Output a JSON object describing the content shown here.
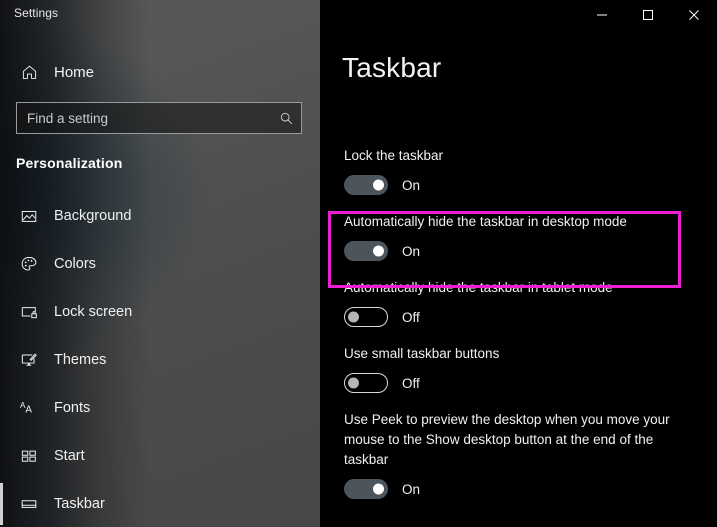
{
  "window": {
    "app_title": "Settings",
    "controls": [
      {
        "name": "minimize",
        "glyph": "—"
      },
      {
        "name": "maximize",
        "glyph": "□"
      },
      {
        "name": "close",
        "glyph": "✕"
      }
    ]
  },
  "sidebar": {
    "home": {
      "label": "Home",
      "icon": "home-icon"
    },
    "search": {
      "placeholder": "Find a setting",
      "icon": "search-icon"
    },
    "section_header": "Personalization",
    "items": [
      {
        "label": "Background",
        "icon": "image-icon",
        "selected": false
      },
      {
        "label": "Colors",
        "icon": "palette-icon",
        "selected": false
      },
      {
        "label": "Lock screen",
        "icon": "lock-screen-icon",
        "selected": false
      },
      {
        "label": "Themes",
        "icon": "themes-brush-icon",
        "selected": false
      },
      {
        "label": "Fonts",
        "icon": "fonts-aa-icon",
        "selected": false
      },
      {
        "label": "Start",
        "icon": "start-tiles-icon",
        "selected": false
      },
      {
        "label": "Taskbar",
        "icon": "taskbar-icon",
        "selected": true
      }
    ]
  },
  "main": {
    "page_title": "Taskbar",
    "settings": [
      {
        "label": "Lock the taskbar",
        "state": "On",
        "toggle": "on",
        "highlighted": false
      },
      {
        "label": "Automatically hide the taskbar in desktop mode",
        "state": "On",
        "toggle": "on",
        "highlighted": true
      },
      {
        "label": "Automatically hide the taskbar in tablet mode",
        "state": "Off",
        "toggle": "off",
        "highlighted": false
      },
      {
        "label": "Use small taskbar buttons",
        "state": "Off",
        "toggle": "off",
        "highlighted": false
      },
      {
        "label": "Use Peek to preview the desktop when you move your mouse to the Show desktop button at the end of the taskbar",
        "state": "On",
        "toggle": "on",
        "highlighted": false
      }
    ]
  },
  "annotation": {
    "highlight_color": "#ee1fd0",
    "target_label": "Automatically hide the taskbar in desktop mode"
  }
}
